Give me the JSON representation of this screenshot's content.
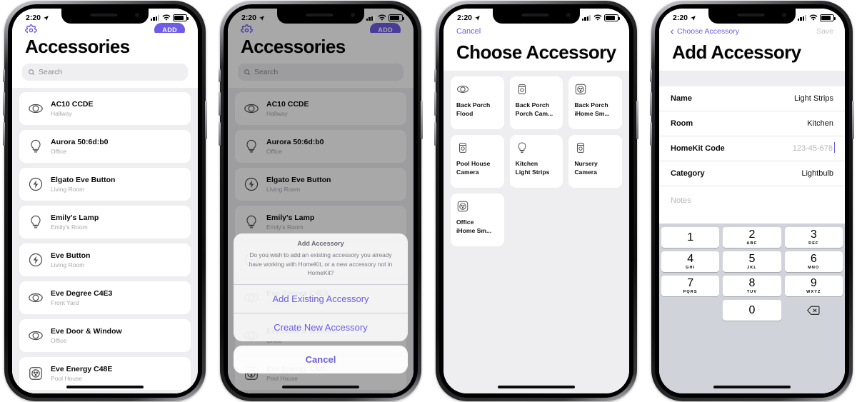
{
  "status_bar": {
    "time": "2:20",
    "location_icon": "location-arrow-icon",
    "signal_icon": "cellular-bars-icon",
    "wifi_icon": "wifi-icon",
    "battery_icon": "battery-icon"
  },
  "theme": {
    "accent": "#6c5ce7",
    "list_background": "#eeeef1",
    "card_background": "#ffffff",
    "keyboard_background": "#d0d4da",
    "disabled_text": "#c3c3c9"
  },
  "screen1": {
    "gear_icon": "gear-icon",
    "add_label": "ADD",
    "title": "Accessories",
    "search_placeholder": "Search",
    "search_icon": "search-icon",
    "accessories": [
      {
        "name": "AC10 CCDE",
        "room": "Hallway",
        "icon": "sensor-icon"
      },
      {
        "name": "Aurora 50:6d:b0",
        "room": "Office",
        "icon": "lightbulb-icon"
      },
      {
        "name": "Elgato Eve Button",
        "room": "Living Room",
        "icon": "button-icon"
      },
      {
        "name": "Emily's Lamp",
        "room": "Emily's Room",
        "icon": "lightbulb-icon"
      },
      {
        "name": "Eve Button",
        "room": "Living Room",
        "icon": "button-icon"
      },
      {
        "name": "Eve Degree C4E3",
        "room": "Front Yard",
        "icon": "sensor-icon"
      },
      {
        "name": "Eve Door & Window",
        "room": "Office",
        "icon": "sensor-icon"
      },
      {
        "name": "Eve Energy C48E",
        "room": "Pool House",
        "icon": "outlet-icon"
      }
    ]
  },
  "screen2": {
    "gear_icon": "gear-icon",
    "add_label": "ADD",
    "title": "Accessories",
    "search_placeholder": "Search",
    "search_icon": "search-icon",
    "accessories": [
      {
        "name": "AC10 CCDE",
        "room": "Hallway",
        "icon": "sensor-icon"
      },
      {
        "name": "Aurora 50:6d:b0",
        "room": "Office",
        "icon": "lightbulb-icon"
      },
      {
        "name": "Elgato Eve Button",
        "room": "Living Room",
        "icon": "button-icon"
      },
      {
        "name": "Emily's Lamp",
        "room": "Emily's Room",
        "icon": "lightbulb-icon"
      },
      {
        "name": "Eve Button",
        "room": "Living Room",
        "icon": "button-icon"
      },
      {
        "name": "Eve Degree C4E3",
        "room": "Front Yard",
        "icon": "sensor-icon"
      },
      {
        "name": "Eve Door & Window",
        "room": "Office",
        "icon": "sensor-icon"
      },
      {
        "name": "Eve Energy C48E",
        "room": "Pool House",
        "icon": "outlet-icon"
      }
    ],
    "action_sheet": {
      "title": "Add Accessory",
      "message": "Do you wish to add an existing accessory you already have working with HomeKit, or a new accessory not in HomeKit?",
      "option_existing": "Add Existing Accessory",
      "option_new": "Create New Accessory",
      "cancel": "Cancel"
    }
  },
  "screen3": {
    "cancel_label": "Cancel",
    "title": "Choose Accessory",
    "cards": [
      {
        "line1": "Back Porch",
        "line2": "Flood",
        "icon": "sensor-icon"
      },
      {
        "line1": "Back Porch",
        "line2": "Porch Cam...",
        "icon": "camera-icon"
      },
      {
        "line1": "Back Porch",
        "line2": "iHome Sm...",
        "icon": "outlet-icon"
      },
      {
        "line1": "Pool House",
        "line2": "Camera",
        "icon": "camera-icon"
      },
      {
        "line1": "Kitchen",
        "line2": "Light Strips",
        "icon": "lightbulb-icon"
      },
      {
        "line1": "Nursery",
        "line2": "Camera",
        "icon": "camera-icon"
      },
      {
        "line1": "Office",
        "line2": "iHome Sm...",
        "icon": "outlet-icon"
      }
    ]
  },
  "screen4": {
    "back_label": "Choose Accessory",
    "back_icon": "chevron-left-icon",
    "save_label": "Save",
    "title": "Add Accessory",
    "fields": [
      {
        "label": "Name",
        "value": "Light Strips",
        "is_placeholder": false
      },
      {
        "label": "Room",
        "value": "Kitchen",
        "is_placeholder": false
      },
      {
        "label": "HomeKit Code",
        "value": "123-45-678",
        "is_placeholder": true
      },
      {
        "label": "Category",
        "value": "Lightbulb",
        "is_placeholder": false
      }
    ],
    "notes_placeholder": "Notes",
    "keypad": [
      {
        "num": "1",
        "sub": ""
      },
      {
        "num": "2",
        "sub": "ABC"
      },
      {
        "num": "3",
        "sub": "DEF"
      },
      {
        "num": "4",
        "sub": "GHI"
      },
      {
        "num": "5",
        "sub": "JKL"
      },
      {
        "num": "6",
        "sub": "MNO"
      },
      {
        "num": "7",
        "sub": "PQRS"
      },
      {
        "num": "8",
        "sub": "TUV"
      },
      {
        "num": "9",
        "sub": "WXYZ"
      },
      {
        "num": "0",
        "sub": ""
      }
    ],
    "delete_icon": "backspace-icon"
  }
}
